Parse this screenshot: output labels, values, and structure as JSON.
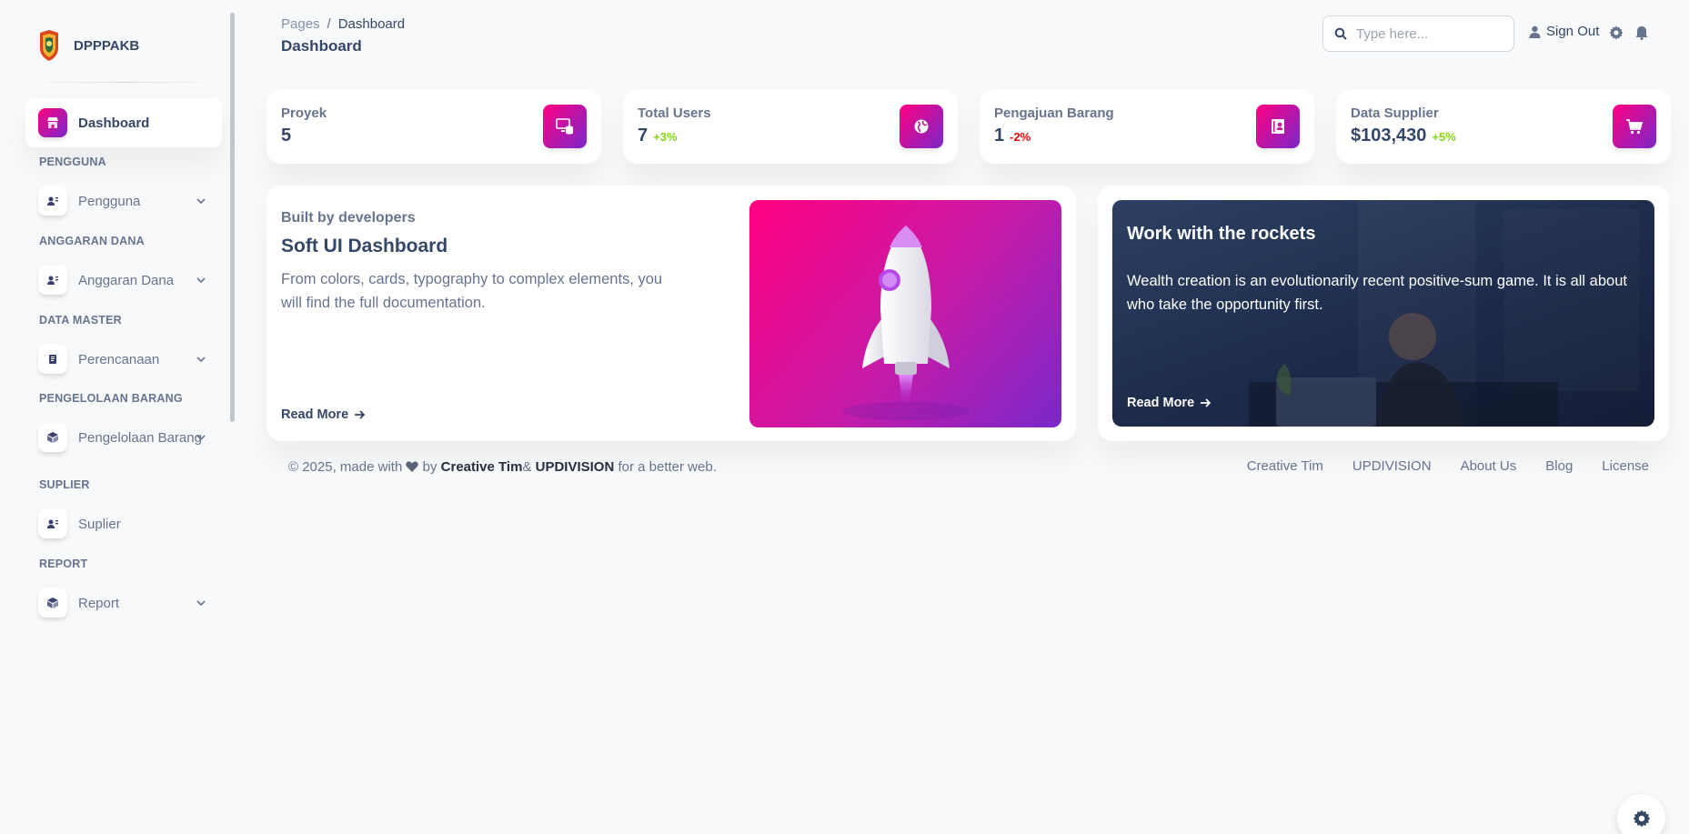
{
  "app": {
    "brand_name": "DPPPAKB"
  },
  "sidebar": {
    "active": {
      "label": "Dashboard",
      "icon": "shop-icon"
    },
    "sections": [
      {
        "title": "PENGGUNA",
        "item": {
          "label": "Pengguna",
          "icon": "user-icon",
          "expandable": true
        }
      },
      {
        "title": "ANGGARAN DANA",
        "item": {
          "label": "Anggaran Dana",
          "icon": "user-icon",
          "expandable": true
        }
      },
      {
        "title": "DATA MASTER",
        "item": {
          "label": "Perencanaan",
          "icon": "document-icon",
          "expandable": true
        }
      },
      {
        "title": "PENGELOLAAN BARANG",
        "item": {
          "label": "Pengelolaan Barang",
          "icon": "box-icon",
          "expandable": true
        }
      },
      {
        "title": "SUPLIER",
        "item": {
          "label": "Suplier",
          "icon": "user-icon",
          "expandable": false
        }
      },
      {
        "title": "REPORT",
        "item": {
          "label": "Report",
          "icon": "box-icon",
          "expandable": true
        }
      }
    ]
  },
  "header": {
    "breadcrumb_root": "Pages",
    "breadcrumb_sep": "/",
    "breadcrumb_current": "Dashboard",
    "title": "Dashboard",
    "search_placeholder": "Type here...",
    "signout_label": "Sign Out"
  },
  "stats": [
    {
      "label": "Proyek",
      "value": "5",
      "change": "",
      "trend": "",
      "icon": "database-screen-icon"
    },
    {
      "label": "Total Users",
      "value": "7",
      "change": "+3%",
      "trend": "up",
      "icon": "globe-icon"
    },
    {
      "label": "Pengajuan Barang",
      "value": "1",
      "change": "-2%",
      "trend": "down",
      "icon": "document-user-icon"
    },
    {
      "label": "Data Supplier",
      "value": "$103,430",
      "change": "+5%",
      "trend": "up",
      "icon": "cart-icon"
    }
  ],
  "card_dev": {
    "subtitle": "Built by developers",
    "title": "Soft UI Dashboard",
    "text": "From colors, cards, typography to complex elements, you will find the full documentation.",
    "link": "Read More"
  },
  "card_rockets": {
    "title": "Work with the rockets",
    "text": "Wealth creation is an evolutionarily recent positive-sum game. It is all about who take the opportunity first.",
    "link": "Read More"
  },
  "footer": {
    "copyright_prefix": "© 2025, made with",
    "by": "by",
    "link1": "Creative Tim",
    "amp": "&",
    "link2": "UPDIVISION",
    "suffix": "for a better web.",
    "links": [
      "Creative Tim",
      "UPDIVISION",
      "About Us",
      "Blog",
      "License"
    ]
  },
  "colors": {
    "primary_gradient_start": "#7928ca",
    "primary_gradient_end": "#ff0080",
    "text_dark": "#344767",
    "text_muted": "#67748e",
    "success": "#82d616",
    "danger": "#ea0606"
  }
}
